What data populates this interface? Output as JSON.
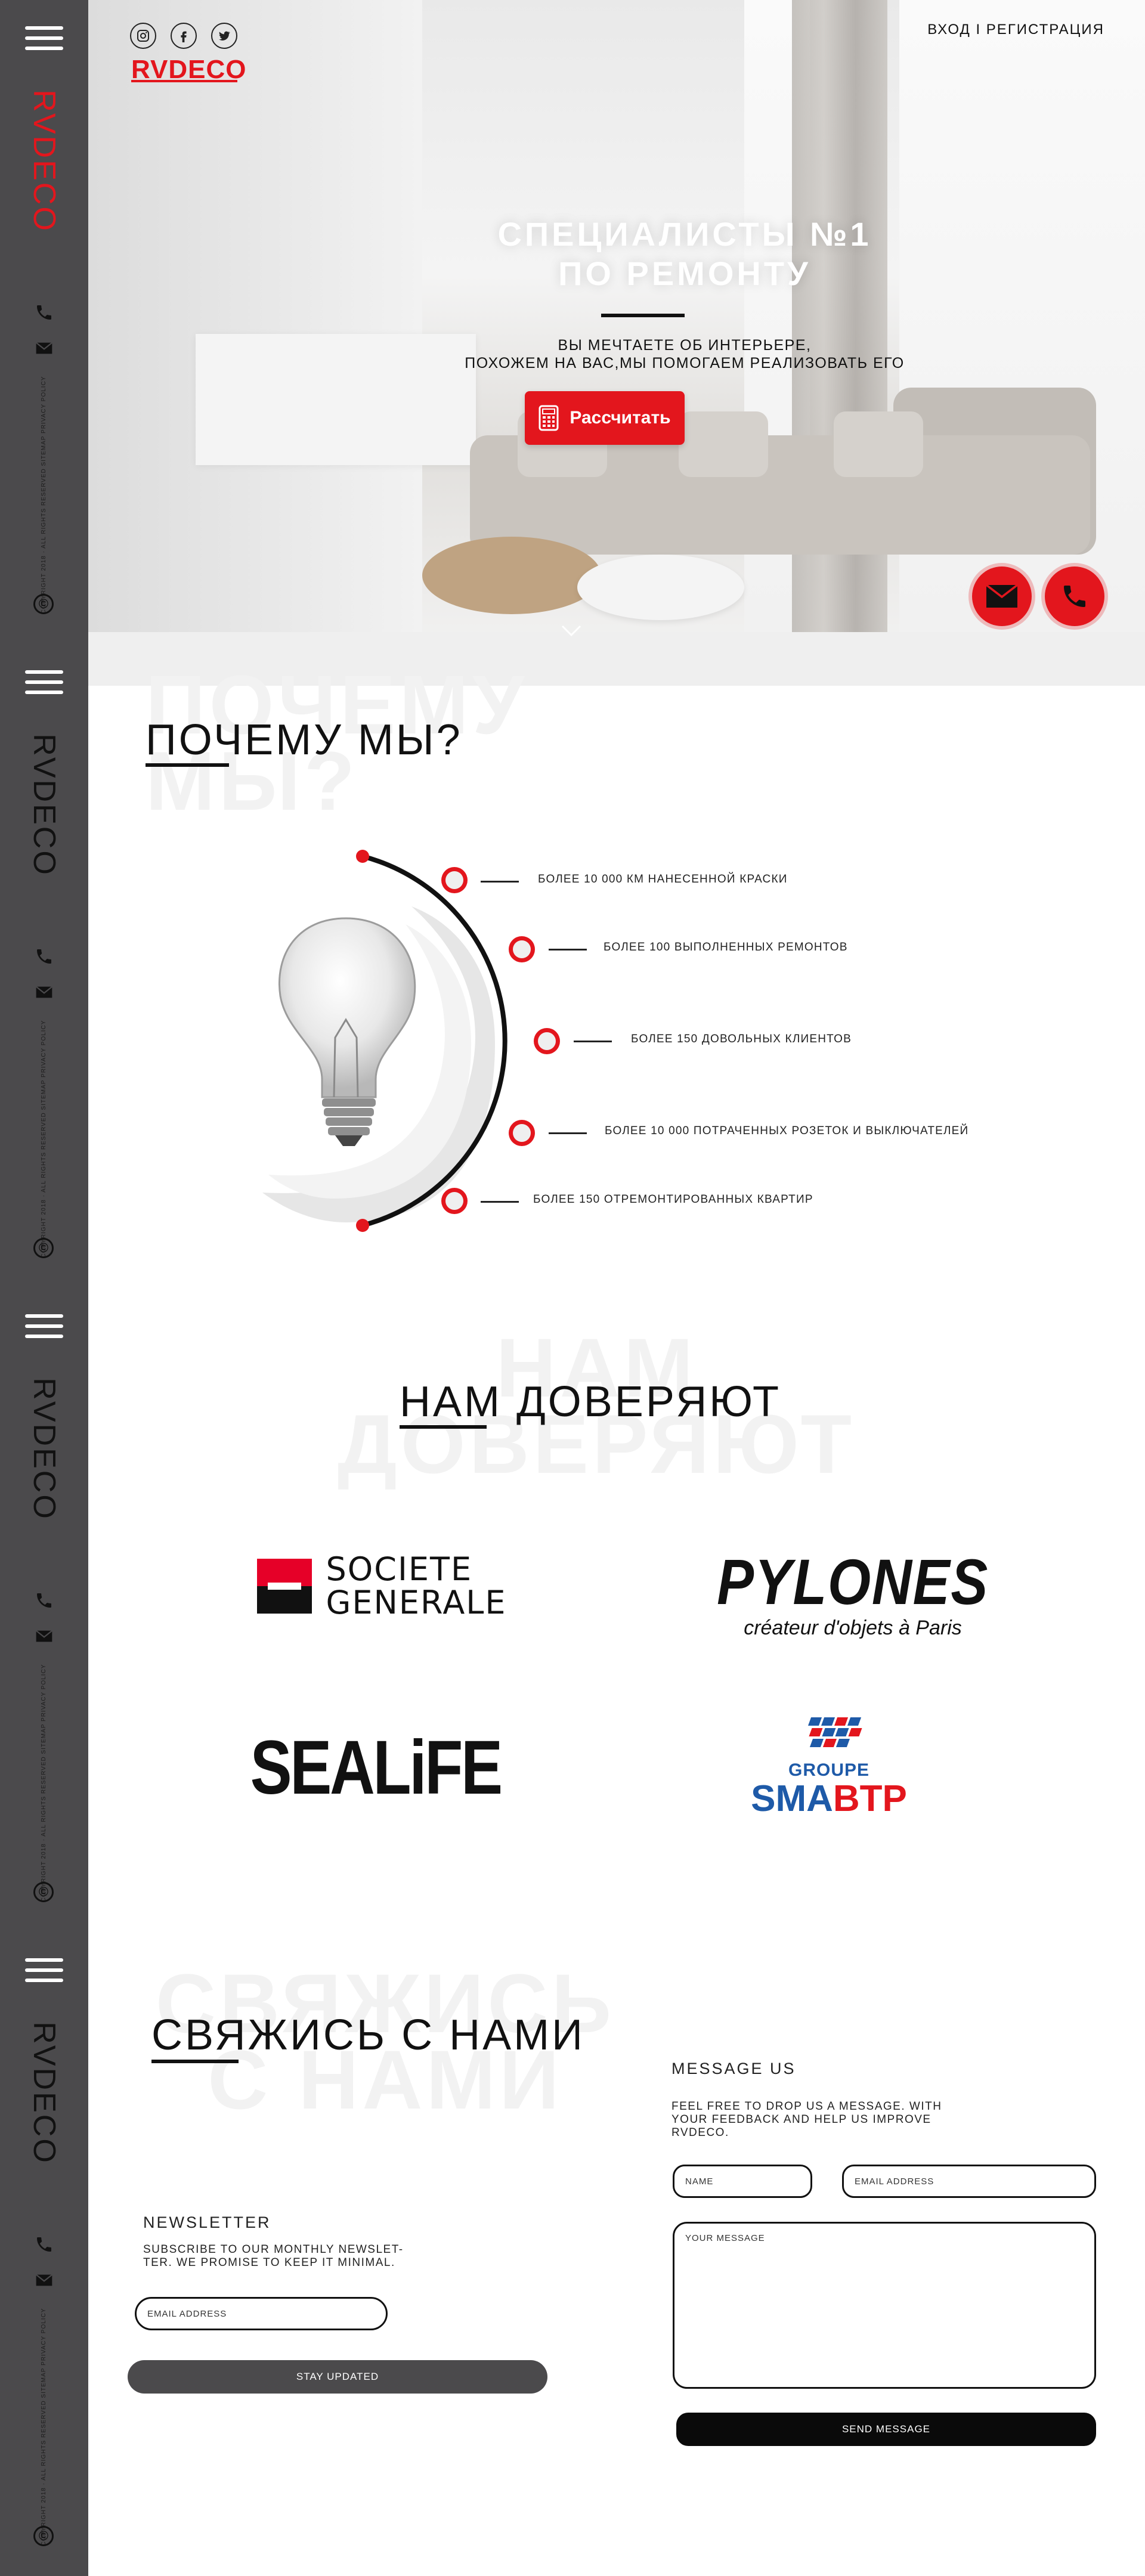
{
  "sidebar": {
    "logo": "RVDECO",
    "legal": "COPYRIGHT 2018 · ALL RIGHTS RESERVED   SITEMAP   PRIVACY POLICY",
    "copyright_symbol": "©"
  },
  "header": {
    "brand": "RVDECO",
    "login": "ВХОД",
    "separator": "I",
    "register": "РЕГИСТРАЦИЯ",
    "social": [
      "instagram-icon",
      "facebook-icon",
      "twitter-icon"
    ]
  },
  "hero": {
    "title_line1": "СПЕЦИАЛИСТЫ №1",
    "title_line2": "ПО РЕМОНТУ",
    "subtitle_line1": "ВЫ МЕЧТАЕТЕ ОБ ИНТЕРЬЕРЕ,",
    "subtitle_line2": "ПОХОЖЕМ НА ВАС,МЫ ПОМОГАЕМ РЕАЛИЗОВАТЬ ЕГО",
    "cta": "Рассчитать"
  },
  "why": {
    "bg_line1": "ПОЧЕМУ",
    "bg_line2": "МЫ?",
    "title": "ПОЧЕМУ МЫ?",
    "features": [
      "БОЛЕЕ 10 000 КМ НАНЕСЕННОЙ КРАСКИ",
      "БОЛЕЕ 100 ВЫПОЛНЕННЫХ РЕМОНТОВ",
      "БОЛЕЕ 150 ДОВОЛЬНЫХ КЛИЕНТОВ",
      "БОЛЕЕ 10 000 ПОТРАЧЕННЫХ РОЗЕТОК И ВЫКЛЮЧАТЕЛЕЙ",
      "БОЛЕЕ 150 ОТРЕМОНТИРОВАННЫХ КВАРТИР"
    ]
  },
  "trust": {
    "bg_line1": "НАМ",
    "bg_line2": "ДОВЕРЯЮТ",
    "title": "НАМ ДОВЕРЯЮТ",
    "logos": {
      "sg_line1": "SOCIETE",
      "sg_line2": "GENERALE",
      "pylones": "PYLONES",
      "pylones_tag": "créateur d'objets à Paris",
      "sealife_a": "SEA",
      "sealife_b": "LiFE",
      "smabtp_line1": "GROUPE",
      "smabtp_sma": "SMA",
      "smabtp_btp": "BTP"
    }
  },
  "contact": {
    "bg_line1": "СВЯЖИСЬ",
    "bg_line2": "С НАМИ",
    "title": "СВЯЖИСЬ С НАМИ",
    "newsletter": {
      "heading": "NEWSLETTER",
      "text_line1": "SUBSCRIBE TO OUR MONTHLY NEWSLET-",
      "text_line2": "TER. WE PROMISE TO KEEP IT MINIMAL.",
      "email_placeholder": "EMAIL ADDRESS",
      "button": "STAY UPDATED"
    },
    "message": {
      "heading": "MESSAGE US",
      "text_line1": "FEEL FREE TO DROP US A MESSAGE. WITH",
      "text_line2": "YOUR FEEDBACK AND HELP US IMPROVE",
      "text_line3": "RVDECO.",
      "name_placeholder": "NAME",
      "email_placeholder": "EMAIL ADDRESS",
      "message_placeholder": "YOUR MESSAGE",
      "button": "SEND MESSAGE"
    }
  },
  "colors": {
    "accent": "#e3161d",
    "sidebar": "#4b4a4c",
    "dark": "#111111",
    "button_gray": "#4b4a4c"
  }
}
